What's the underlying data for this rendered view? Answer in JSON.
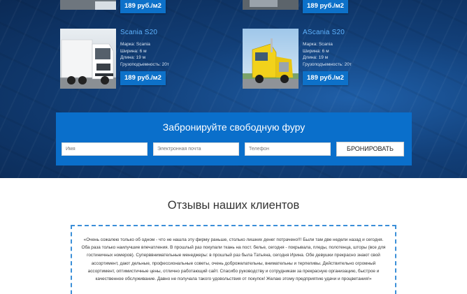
{
  "trucks": [
    {
      "title": "",
      "specs": [],
      "price": "189 руб./м2"
    },
    {
      "title": "",
      "specs": [],
      "price": "189 руб./м2"
    },
    {
      "title": "Scania S20",
      "specs": [
        "Марка: Scania",
        "Ширина: 6 м",
        "Длина: 19 м",
        "Грузоподъемность: 20т"
      ],
      "price": "189 руб./м2"
    },
    {
      "title": "AScania S20",
      "specs": [
        "Марка: Scania",
        "Ширина: 6 м",
        "Длина: 19 м",
        "Грузоподъемность: 20т"
      ],
      "price": "189 руб./м2"
    }
  ],
  "booking": {
    "title": "Забронируйте свободную фуру",
    "name_placeholder": "Имя",
    "email_placeholder": "Электронная почта",
    "phone_placeholder": "Телефон",
    "submit_label": "БРОНИРОВАТЬ"
  },
  "reviews": {
    "title": "Отзывы наших клиентов",
    "text": "«Очень сожалею только об одном - что не нашла эту фирму раньше, столько лишних денег потрачено!!! Были там две недели назад и сегодня. Оба раза только наилучшие впечатления. В прошлый раз покупали ткань на пост. белье, сегодня - покрывала, пледы, полотенца, шторы (все для гостиничных номеров). Суперввнимательные менеджеры: в прошлый раз была Татьяна, сегодня Ирина. Обе девушки прекрасно знают свой ассортимент, дают дельные, профессиональные советы, очень доброжелательны, внимательны и терпеливы. Действительно огромный ассортимент, оптимистичные цены, отлично работающий сайт. Спасибо руководству и сотрудникам за прекрасную организацию, быстрое и качественное обслуживание. Давно не получала такого удовольствия от покупок! Желаю этому предприятию удачи и процветания!»"
  },
  "colors": {
    "accent": "#0a6fcb",
    "title_blue": "#5fb4ff",
    "review_border": "#3b8fd8"
  }
}
